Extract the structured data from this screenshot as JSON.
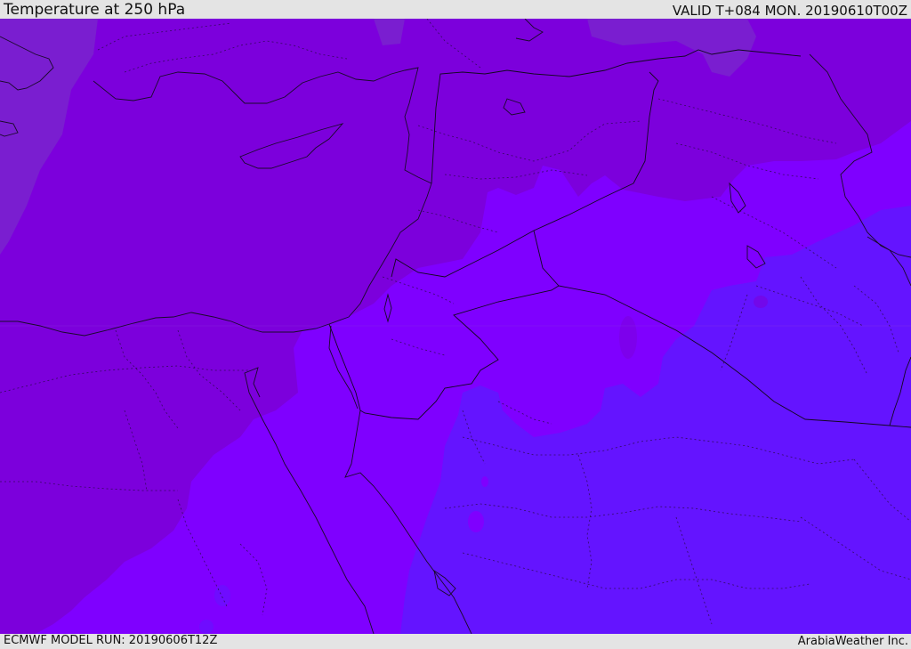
{
  "header": {
    "title": "Temperature at 250 hPa",
    "valid": "VALID T+084 MON. 20190610T00Z"
  },
  "footer": {
    "model_run": "ECMWF MODEL RUN: 20190606T12Z",
    "credit": "ArabiaWeather Inc."
  },
  "map": {
    "field": "Temperature at 250 hPa",
    "colors": {
      "warmest_band": "#7a1ed0",
      "warm_band": "#7c00dc",
      "mid_band": "#7f00ff",
      "cool_band": "#6414ff",
      "coastline": "#1a0a2a"
    }
  }
}
